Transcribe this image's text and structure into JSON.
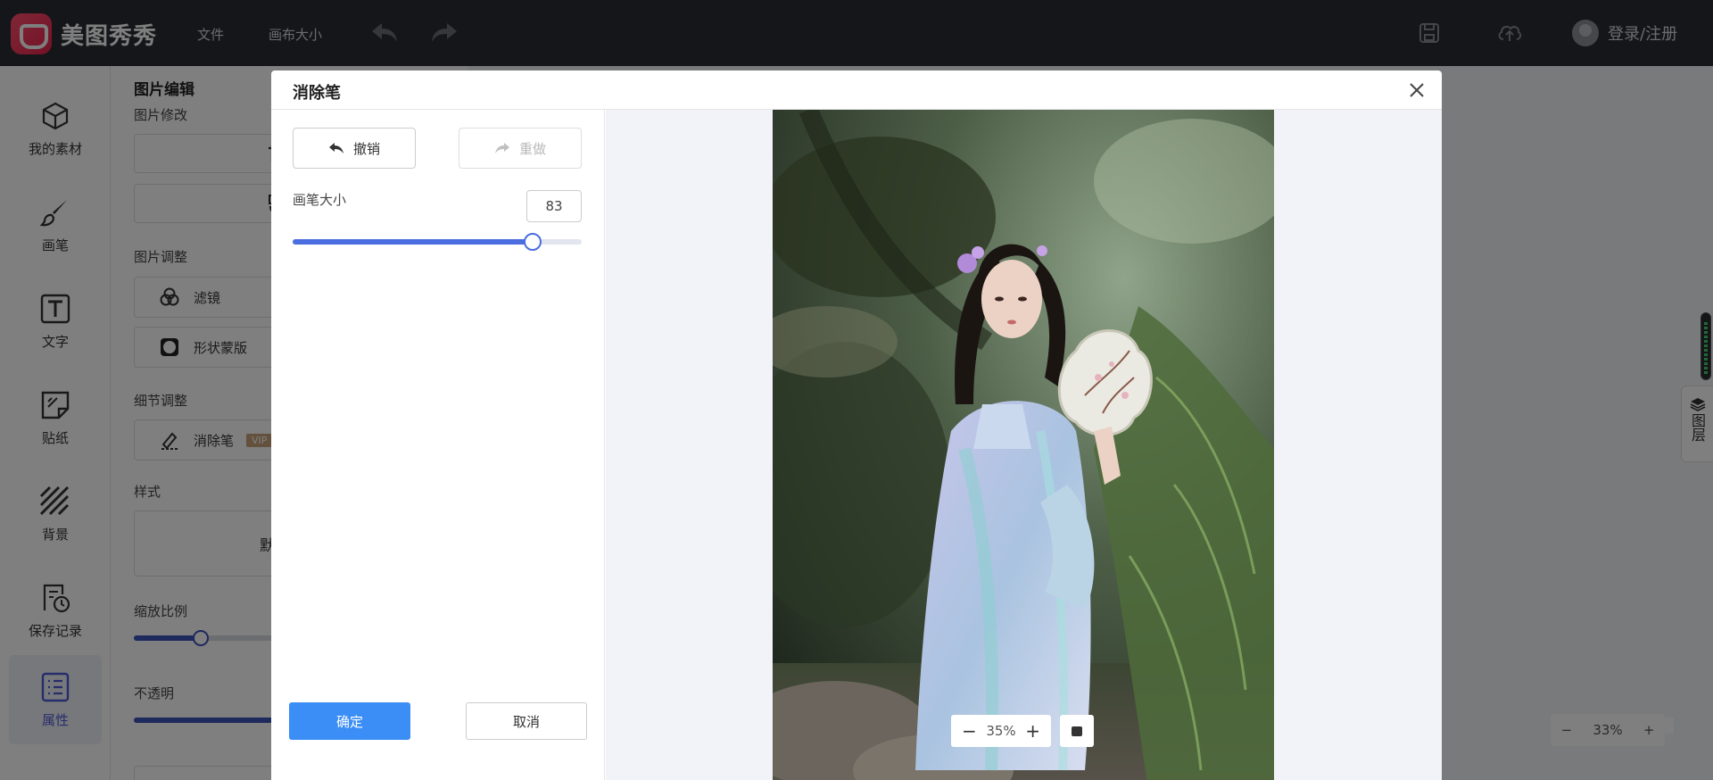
{
  "app": {
    "name": "美图秀秀",
    "brand_color": "#e8234d"
  },
  "topbar": {
    "menu": [
      "文件",
      "画布大小"
    ],
    "login_label": "登录/注册",
    "icons": [
      "undo-icon",
      "redo-icon",
      "save-icon",
      "cloud-upload-icon"
    ]
  },
  "sidebar": {
    "items": [
      {
        "label": "我的素材",
        "icon": "cube-icon"
      },
      {
        "label": "画笔",
        "icon": "brush-icon"
      },
      {
        "label": "文字",
        "icon": "text-icon"
      },
      {
        "label": "贴纸",
        "icon": "sticker-icon"
      },
      {
        "label": "背景",
        "icon": "stripes-icon"
      },
      {
        "label": "保存记录",
        "icon": "history-icon"
      },
      {
        "label": "属性",
        "icon": "list-icon",
        "active": true
      }
    ]
  },
  "panel": {
    "title": "图片编辑",
    "section_modify": "图片修改",
    "section_adjust": "图片调整",
    "filter_label": "滤镜",
    "shape_mask_label": "形状蒙版",
    "section_detail": "细节调整",
    "eraser_label": "消除笔",
    "vip_badge": "VIP",
    "section_style": "样式",
    "style_partial": "默",
    "section_scale": "缩放比例",
    "scale_value": 0.22,
    "section_opacity": "不透明",
    "opacity_value": 1.0
  },
  "right": {
    "layers_label": "图层",
    "zoom": {
      "value": "33%",
      "minus": "−",
      "plus": "+"
    }
  },
  "modal": {
    "title": "消除笔",
    "undo_label": "撤销",
    "redo_label": "重做",
    "brush_size_label": "画笔大小",
    "brush_size_value": "83",
    "brush_slider_fraction": 0.83,
    "confirm_label": "确定",
    "cancel_label": "取消",
    "zoom": {
      "value": "35%",
      "minus": "−",
      "plus": "+"
    },
    "accent_color": "#3b8ef5"
  }
}
